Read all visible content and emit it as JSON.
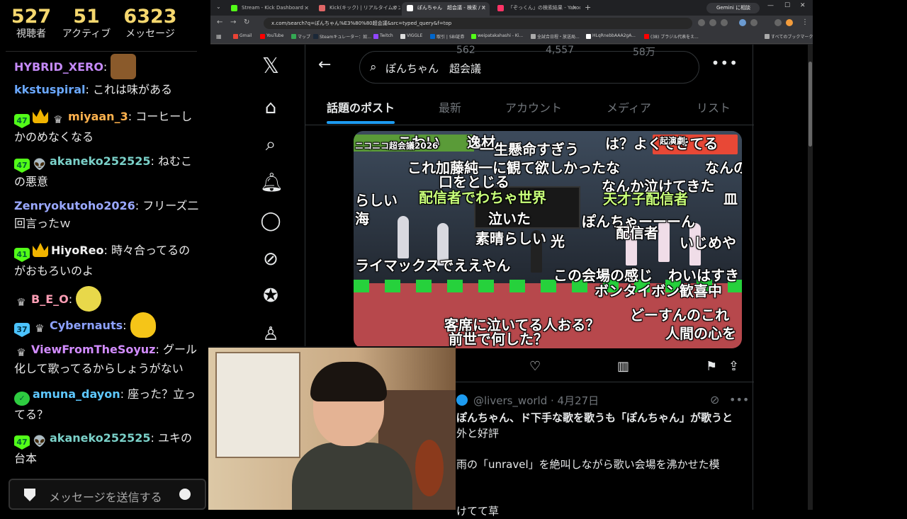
{
  "chat": {
    "stats": [
      {
        "value": "527",
        "label": "視聴者"
      },
      {
        "value": "51",
        "label": "アクティブ"
      },
      {
        "value": "6323",
        "label": "メッセージ"
      }
    ],
    "messages": [
      {
        "user": "HYBRID_XERO",
        "text": "",
        "color": "#c58af9"
      },
      {
        "user": "kkstuspiral",
        "text": "これは味がある",
        "color": "#6aa8ff"
      },
      {
        "badge": "47",
        "user": "miyaan_3",
        "text": "コーヒーしかのめなくなる",
        "color": "#ffb24d"
      },
      {
        "badge": "47",
        "user": "akaneko252525",
        "text": "ねむこの悪意",
        "color": "#7ad0c8"
      },
      {
        "user": "Zenryokutoho2026",
        "text": "フリーズ二回言ったｗ",
        "color": "#9aa8ff"
      },
      {
        "badge": "41",
        "user": "HiyoReo",
        "text": "時々合ってるのがおもろいのよ",
        "color": "#f0f0f0"
      },
      {
        "user": "B_E_O",
        "text": "",
        "color": "#ff9eb5"
      },
      {
        "badge": "37",
        "user": "Cybernauts",
        "text": "",
        "color": "#8da2ff"
      },
      {
        "user": "ViewFromTheSoyuz",
        "text": "グール化して歌ってるからしょうがない",
        "color": "#d28cff"
      },
      {
        "user": "amuna_dayon",
        "text": "座った？立ってる？",
        "color": "#5ec8ff"
      },
      {
        "badge": "47",
        "user": "akaneko252525",
        "text": "ユキの台本",
        "color": "#7ad0c8"
      }
    ],
    "input_placeholder": "メッセージを送信する"
  },
  "browser": {
    "tabs": [
      {
        "title": "Stream - Kick Dashboard",
        "color": "#53fc18"
      },
      {
        "title": "Kick(キック) | リアルタイムランキング",
        "color": "#e06666"
      },
      {
        "title": "ぽんちゃん　超会議 - 検索 / X",
        "color": "#ffffff"
      },
      {
        "title": "「ぞっくん」の検索結果 - Yahoo!検索",
        "color": "#ff3366"
      }
    ],
    "gemini_label": "Gemini に相談",
    "url": "x.com/search?q=ぽんちゃん%E3%80%80超会議&src=typed_query&f=top",
    "bookmarks": [
      "Gmail",
      "YouTube",
      "マップ",
      "Steamキュレーター：奴...",
      "Twitch",
      "VIGGLE",
      "取引 | SBI証券",
      "weipatakahashi - Ki...",
      "全試合日程・放送局...",
      "HLqRnebbAAA2gA...",
      "(38) ブラジル代表をえ...",
      "すべてのブックマーク"
    ]
  },
  "x": {
    "search_query": "ぽんちゃん　超会議",
    "tabs": [
      "話題のポスト",
      "最新",
      "アカウント",
      "メディア",
      "リスト"
    ],
    "comments": [
      "こわい",
      "逸材",
      "は？よくできてる",
      "起演劇",
      "ニコニコ超会議2026",
      "一生懸命すぎう",
      "これ加藤純一に観て欲しかったな",
      "なんの",
      "口をとじる",
      "配信者でわちゃ世界",
      "なんか泣けてきた",
      "天才子配信者",
      "皿",
      "らしい",
      "泣いた",
      "ぽんちゃーーーん",
      "いじめや",
      "素晴らしい",
      "光",
      "配信者",
      "海",
      "ライマックスでええやん",
      "この会場の感じ",
      "わいはすき",
      "ボンタイボン歓喜中",
      "どーすんのこれ",
      "客席に泣いてる人おる？",
      "前世で何した？",
      "人間の心を"
    ],
    "post_stats": {
      "replies": "562",
      "likes": "4,557",
      "views": "58万"
    },
    "post2": {
      "handle": "@livers_world · 4月27日",
      "lines": [
        "ぽんちゃん、ド下手な歌を歌うも「ぽんちゃん」が歌うと",
        "外と好評",
        "",
        "雨の「unravel」を絶叫しながら歌い会場を沸かせた模",
        "",
        "",
        "けてて草"
      ]
    }
  }
}
